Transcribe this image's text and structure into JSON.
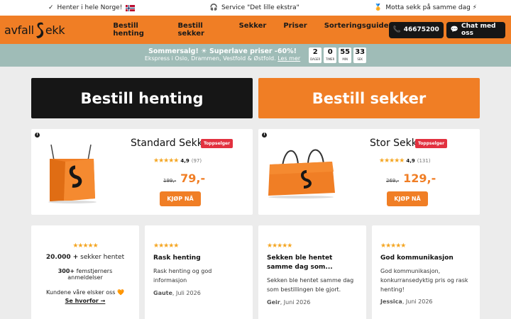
{
  "topbar": {
    "left": "Henter i hele Norge!",
    "center": "Service \"Det lille ekstra\"",
    "right": "Motta sekk på samme dag ⚡"
  },
  "header": {
    "logo_left": "avfall",
    "logo_right": "ekk",
    "nav": [
      "Bestill henting",
      "Bestill sekker",
      "Sekker",
      "Priser",
      "Sorteringsguide"
    ],
    "phone": "46675200",
    "chat": "Chat med oss"
  },
  "promo": {
    "line1": "Sommersalg! ☀ Superlave priser -60%!",
    "line2": "Ekspress i Oslo, Drammen, Vestfold & Østfold.",
    "link": "Les mer",
    "countdown": [
      {
        "value": "2",
        "label": "DAGER"
      },
      {
        "value": "0",
        "label": "TIMER"
      },
      {
        "value": "55",
        "label": "MIN"
      },
      {
        "value": "33",
        "label": "SEK"
      }
    ]
  },
  "ctas": {
    "henting": "Bestill henting",
    "sekker": "Bestill sekker"
  },
  "products": [
    {
      "name": "Standard Sekk",
      "badge": "Toppselger",
      "stars": "★★★★★",
      "score": "4,9",
      "count": "(97)",
      "old_price": "199,-",
      "price": "79,-",
      "buy": "KJØP NÅ"
    },
    {
      "name": "Stor Sekk",
      "badge": "Toppselger",
      "stars": "★★★★★",
      "score": "4,9",
      "count": "(131)",
      "old_price": "269,-",
      "price": "129,-",
      "buy": "KJØP NÅ"
    }
  ],
  "summary": {
    "stars": "★★★★★",
    "count": "20.000 +",
    "count_suffix": " sekker hentet",
    "reviews_count": "300+",
    "reviews_suffix": " femstjerners anmeldelser",
    "love": "Kundene våre elsker oss 🧡",
    "why": "Se hvorfor →"
  },
  "reviews": [
    {
      "stars": "★★★★★",
      "title": "Rask henting",
      "body": "Rask henting og god informasjon",
      "author": "Gaute",
      "date": ", Juli 2026"
    },
    {
      "stars": "★★★★★",
      "title": "Sekken ble hentet samme dag som...",
      "body": "Sekken ble hentet samme dag som bestillingen ble gjort.",
      "author": "Geir",
      "date": ", Juni 2026"
    },
    {
      "stars": "★★★★★",
      "title": "God kommunikasjon",
      "body": "God kommunikasjon, konkurransedyktig pris og rask henting!",
      "author": "Jessica",
      "date": ", Juni 2026"
    }
  ],
  "colors": {
    "brand_orange": "#f07e25",
    "dark": "#161616",
    "promo_bg": "#9fbcb7",
    "badge_red": "#e2313f",
    "star": "#f4a623"
  }
}
